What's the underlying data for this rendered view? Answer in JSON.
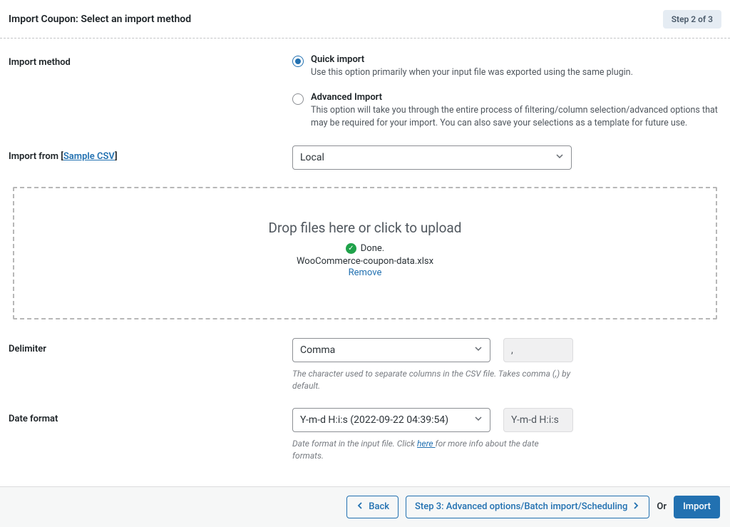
{
  "header": {
    "title": "Import Coupon: Select an import method",
    "step_badge": "Step 2 of 3"
  },
  "import_method": {
    "label": "Import method",
    "quick": {
      "title": "Quick import",
      "desc": "Use this option primarily when your input file was exported using the same plugin."
    },
    "advanced": {
      "title": "Advanced Import",
      "desc": "This option will take you through the entire process of filtering/column selection/advanced options that may be required for your import. You can also save your selections as a template for future use."
    }
  },
  "import_from": {
    "label_prefix": "Import from [",
    "sample_link": "Sample CSV",
    "label_suffix": "]",
    "value": "Local"
  },
  "dropzone": {
    "title": "Drop files here or click to upload",
    "status": "Done.",
    "filename": "WooCommerce-coupon-data.xlsx",
    "remove": "Remove"
  },
  "delimiter": {
    "label": "Delimiter",
    "value": "Comma",
    "char": ",",
    "helper": "The character used to separate columns in the CSV file. Takes comma (,) by default."
  },
  "date_format": {
    "label": "Date format",
    "value": "Y-m-d H:i:s (2022-09-22 04:39:54)",
    "raw": "Y-m-d H:i:s",
    "helper_prefix": "Date format in the input file. Click ",
    "helper_link": "here ",
    "helper_suffix": "for more info about the date formats."
  },
  "footer": {
    "back": "Back",
    "step3": "Step 3: Advanced options/Batch import/Scheduling",
    "or": "Or",
    "import": "Import"
  }
}
